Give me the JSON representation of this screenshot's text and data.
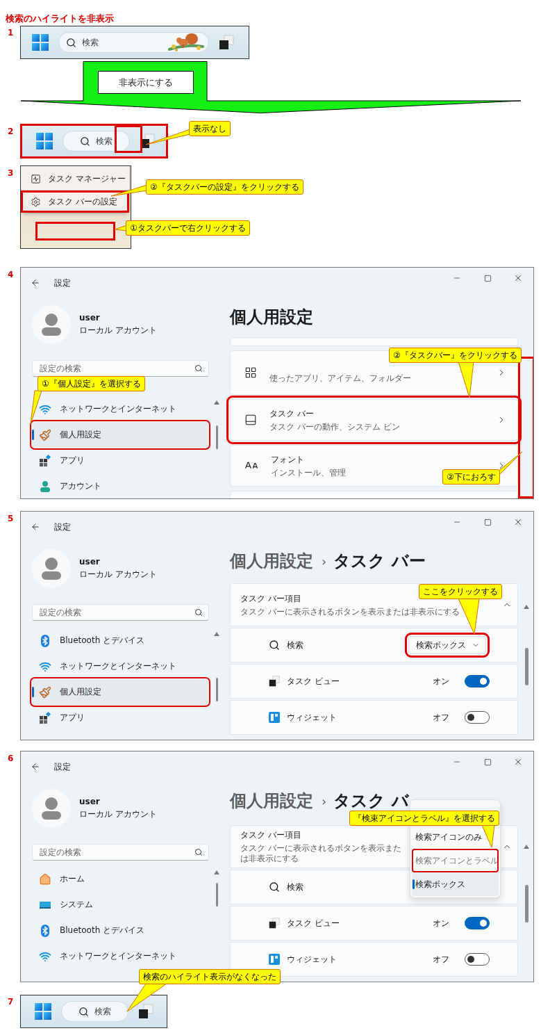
{
  "title": "検索のハイライトを非表示",
  "sections": [
    {
      "kind": "taskbar",
      "number": "1",
      "search_label": "検索",
      "highlight": true,
      "marked": false,
      "framed": false
    },
    {
      "kind": "arrow",
      "label": "非表示にする"
    },
    {
      "kind": "taskbar",
      "number": "2",
      "search_label": "検索",
      "highlight": false,
      "marked": true,
      "framed": true,
      "callouts": [
        "表示なし"
      ]
    },
    {
      "kind": "context_menu",
      "number": "3",
      "items": [
        {
          "label": "タスク マネージャー",
          "highlighted": false
        },
        {
          "label": "タスク バーの設定",
          "highlighted": true
        }
      ],
      "taskbar_marked": true,
      "callouts": [
        "②『タスクバーの設定』をクリックする",
        "①タスクバーで右クリックする"
      ]
    },
    {
      "kind": "settings",
      "number": "4",
      "window_title": "設定",
      "user": "user",
      "account": "ローカル アカウント",
      "search_placeholder": "設定の検索",
      "nav": [
        {
          "label": "ネットワークとインターネット",
          "kind": "wifi",
          "selected": false,
          "highlighted": false
        },
        {
          "label": "個人用設定",
          "kind": "brush",
          "selected": true,
          "highlighted": true
        },
        {
          "label": "アプリ",
          "kind": "apps",
          "selected": false,
          "highlighted": false
        },
        {
          "label": "アカウント",
          "kind": "account",
          "selected": false,
          "highlighted": false
        }
      ],
      "heading": {
        "crumbs": [
          "個人用設定"
        ]
      },
      "content": {
        "kind": "cards",
        "cards": [
          {
            "kind": "partial"
          },
          {
            "kind": "start",
            "subtitle": "使ったアプリ、アイテム、フォルダー",
            "highlighted": false
          },
          {
            "kind": "taskbar",
            "title": "タスク バー",
            "subtitle": "タスク バーの動作、システム ピン",
            "highlighted": true
          },
          {
            "kind": "font",
            "title": "フォント",
            "subtitle": "インストール、管理",
            "highlighted": false
          },
          {
            "kind": "partial"
          }
        ]
      },
      "scrollbar_highlighted": true,
      "callouts": [
        "②『タスクバー』をクリックする",
        "①『個人設定』を選択する",
        "②下におろす"
      ]
    },
    {
      "kind": "settings",
      "number": "5",
      "window_title": "設定",
      "user": "user",
      "account": "ローカル アカウント",
      "search_placeholder": "設定の検索",
      "nav": [
        {
          "label": "Bluetooth とデバイス",
          "kind": "bluetooth",
          "selected": false,
          "highlighted": false
        },
        {
          "label": "ネットワークとインターネット",
          "kind": "wifi",
          "selected": false,
          "highlighted": false
        },
        {
          "label": "個人用設定",
          "kind": "brush",
          "selected": true,
          "highlighted": true
        },
        {
          "label": "アプリ",
          "kind": "apps",
          "selected": false,
          "highlighted": false
        }
      ],
      "heading": {
        "crumbs": [
          "個人用設定",
          "タスク バー"
        ],
        "separator": "›"
      },
      "content": {
        "kind": "items",
        "group": {
          "title": "タスク バー項目",
          "subtitle": "タスク バーに表示されるボタンを表示または非表示にする",
          "expanded": true
        },
        "rows": [
          {
            "kind": "dropdown",
            "label": "検索",
            "value": "検索ボックス",
            "highlighted": true
          },
          {
            "kind": "toggle",
            "label": "タスク ビュー",
            "state_label": "オン",
            "on": true
          },
          {
            "kind": "toggle",
            "label": "ウィジェット",
            "state_label": "オフ",
            "on": false
          }
        ]
      },
      "scrollbar_highlighted": false,
      "callouts": [
        "ここをクリックする"
      ]
    },
    {
      "kind": "settings",
      "number": "6",
      "window_title": "設定",
      "user": "user",
      "account": "ローカル アカウント",
      "search_placeholder": "設定の検索",
      "nav": [
        {
          "label": "ホーム",
          "kind": "home",
          "selected": false,
          "highlighted": false
        },
        {
          "label": "システム",
          "kind": "system",
          "selected": false,
          "highlighted": false
        },
        {
          "label": "Bluetooth とデバイス",
          "kind": "bluetooth",
          "selected": false,
          "highlighted": false
        },
        {
          "label": "ネットワークとインターネット",
          "kind": "wifi",
          "selected": false,
          "highlighted": false
        }
      ],
      "heading": {
        "crumbs": [
          "個人用設定",
          "タスク バ"
        ],
        "separator": "›"
      },
      "content": {
        "kind": "items",
        "group": {
          "title": "タスク バー項目",
          "subtitle": "タスク バーに表示されるボタンを表示または非表示にする",
          "expanded": true
        },
        "rows": [
          {
            "kind": "covered",
            "label": "検索"
          },
          {
            "kind": "toggle",
            "label": "タスク ビュー",
            "state_label": "オン",
            "on": true
          },
          {
            "kind": "toggle",
            "label": "ウィジェット",
            "state_label": "オフ",
            "on": false
          }
        ]
      },
      "menu": {
        "items": [
          {
            "label": "検索アイコンのみ",
            "selected": false,
            "highlighted": false,
            "greyed": false
          },
          {
            "label": "検索アイコンとラベル",
            "selected": false,
            "highlighted": true,
            "greyed": true
          },
          {
            "label": "検索ボックス",
            "selected": true,
            "highlighted": false,
            "greyed": false
          }
        ]
      },
      "scrollbar_highlighted": false,
      "callouts": [
        "『検束アイコンとラベル』を選択する"
      ]
    },
    {
      "kind": "taskbar",
      "number": "7",
      "search_label": "検索",
      "highlight": false,
      "marked": false,
      "framed": false,
      "callouts": [
        "検索のハイライト表示がなくなった"
      ]
    }
  ]
}
